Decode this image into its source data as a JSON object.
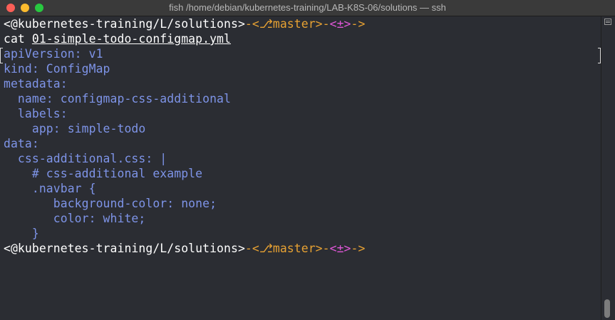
{
  "window": {
    "title": "fish /home/debian/kubernetes-training/LAB-K8S-06/solutions — ssh"
  },
  "prompt1": {
    "path": "<@kubernetes-training/L/solutions>",
    "sep1": "-<",
    "branch_icon": "⎇",
    "branch": "master",
    "sep2": ">-",
    "status": "<±>",
    "sep3": "->"
  },
  "command": {
    "cmd": "cat ",
    "arg": "01-simple-todo-configmap.yml"
  },
  "output": [
    "apiVersion: v1",
    "kind: ConfigMap",
    "metadata:",
    "  name: configmap-css-additional",
    "  labels:",
    "    app: simple-todo",
    "data:",
    "  css-additional.css: |",
    "    # css-additional example",
    "    .navbar {",
    "       background-color: none;",
    "       color: white;",
    "    }"
  ],
  "prompt2": {
    "path": "<@kubernetes-training/L/solutions>",
    "sep1": "-<",
    "branch_icon": "⎇",
    "branch": "master",
    "sep2": ">-",
    "status": "<±>",
    "sep3": "->"
  },
  "colors": {
    "background": "#2b2d33",
    "text": "#ffffff",
    "output": "#7e94e8",
    "branch": "#e8a233",
    "status": "#e157d9"
  }
}
